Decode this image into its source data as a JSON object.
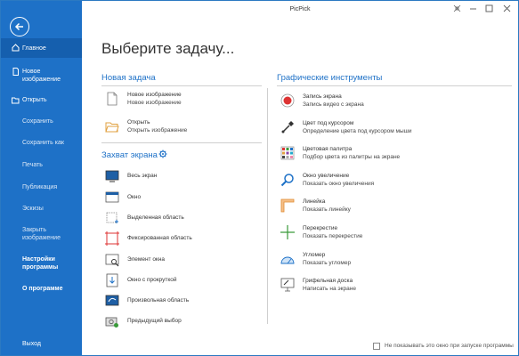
{
  "app": {
    "title": "PicPick"
  },
  "sidebar": {
    "items": [
      {
        "label": "Главное"
      },
      {
        "label": "Новое\nизображение"
      },
      {
        "label": "Открыть"
      },
      {
        "label": "Сохранить"
      },
      {
        "label": "Сохранить как"
      },
      {
        "label": "Печать"
      },
      {
        "label": "Публикация"
      },
      {
        "label": "Эскизы"
      },
      {
        "label": "Закрыть\nизображение"
      },
      {
        "label": "Настройки\nпрограммы"
      },
      {
        "label": "О программе"
      },
      {
        "label": "Выход"
      }
    ]
  },
  "main": {
    "heading": "Выберите задачу...",
    "new_task": {
      "title": "Новая задача",
      "items": [
        {
          "line1": "Новое изображение",
          "line2": "Новое изображение"
        },
        {
          "line1": "Открыть",
          "line2": "Открыть изображение"
        }
      ]
    },
    "capture": {
      "title": "Захват экрана",
      "items": [
        {
          "label": "Весь экран"
        },
        {
          "label": "Окно"
        },
        {
          "label": "Выделенная область"
        },
        {
          "label": "Фиксированная область"
        },
        {
          "label": "Элемент окна"
        },
        {
          "label": "Окно с прокруткой"
        },
        {
          "label": "Произвольная область"
        },
        {
          "label": "Предыдущий выбор"
        }
      ]
    },
    "graphics": {
      "title": "Графические инструменты",
      "items": [
        {
          "line1": "Запись экрана",
          "line2": "Запись видео с экрана"
        },
        {
          "line1": "Цвет под курсором",
          "line2": "Определение цвета под курсором мыши"
        },
        {
          "line1": "Цветовая палитра",
          "line2": "Подбор цвета из палитры на экране"
        },
        {
          "line1": "Окно увеличение",
          "line2": "Показать окно увеличения"
        },
        {
          "line1": "Линейка",
          "line2": "Показать линейку"
        },
        {
          "line1": "Перекрестие",
          "line2": "Показать перекрестие"
        },
        {
          "line1": "Угломер",
          "line2": "Показать угломер"
        },
        {
          "line1": "Грифельная доска",
          "line2": "Написать на экране"
        }
      ]
    }
  },
  "footer": {
    "checkbox_label": "Не показывать это окно при запуске программы",
    "checked": false
  },
  "colors": {
    "accent": "#1e71c7",
    "sidebar_active": "#155fae"
  }
}
